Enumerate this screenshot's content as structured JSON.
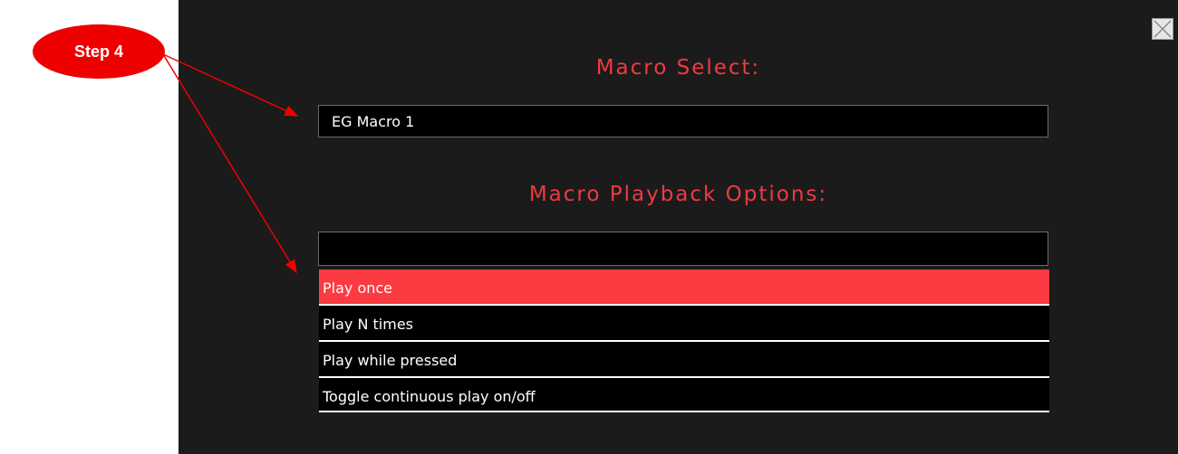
{
  "callout": {
    "label": "Step 4"
  },
  "dialog": {
    "close_icon": "close-icon",
    "macro_select": {
      "title": "Macro Select:",
      "value": "EG Macro 1"
    },
    "playback": {
      "title": "Macro Playback Options:",
      "value": "",
      "options": [
        {
          "label": "Play once",
          "selected": true
        },
        {
          "label": "Play N times",
          "selected": false
        },
        {
          "label": "Play while pressed",
          "selected": false
        },
        {
          "label": "Toggle continuous play on/off",
          "selected": false
        }
      ]
    }
  },
  "colors": {
    "accent": "#ee3a43",
    "selected_option": "#fc3a41",
    "dialog_bg": "#1b1b1b",
    "callout": "#ef0000"
  }
}
